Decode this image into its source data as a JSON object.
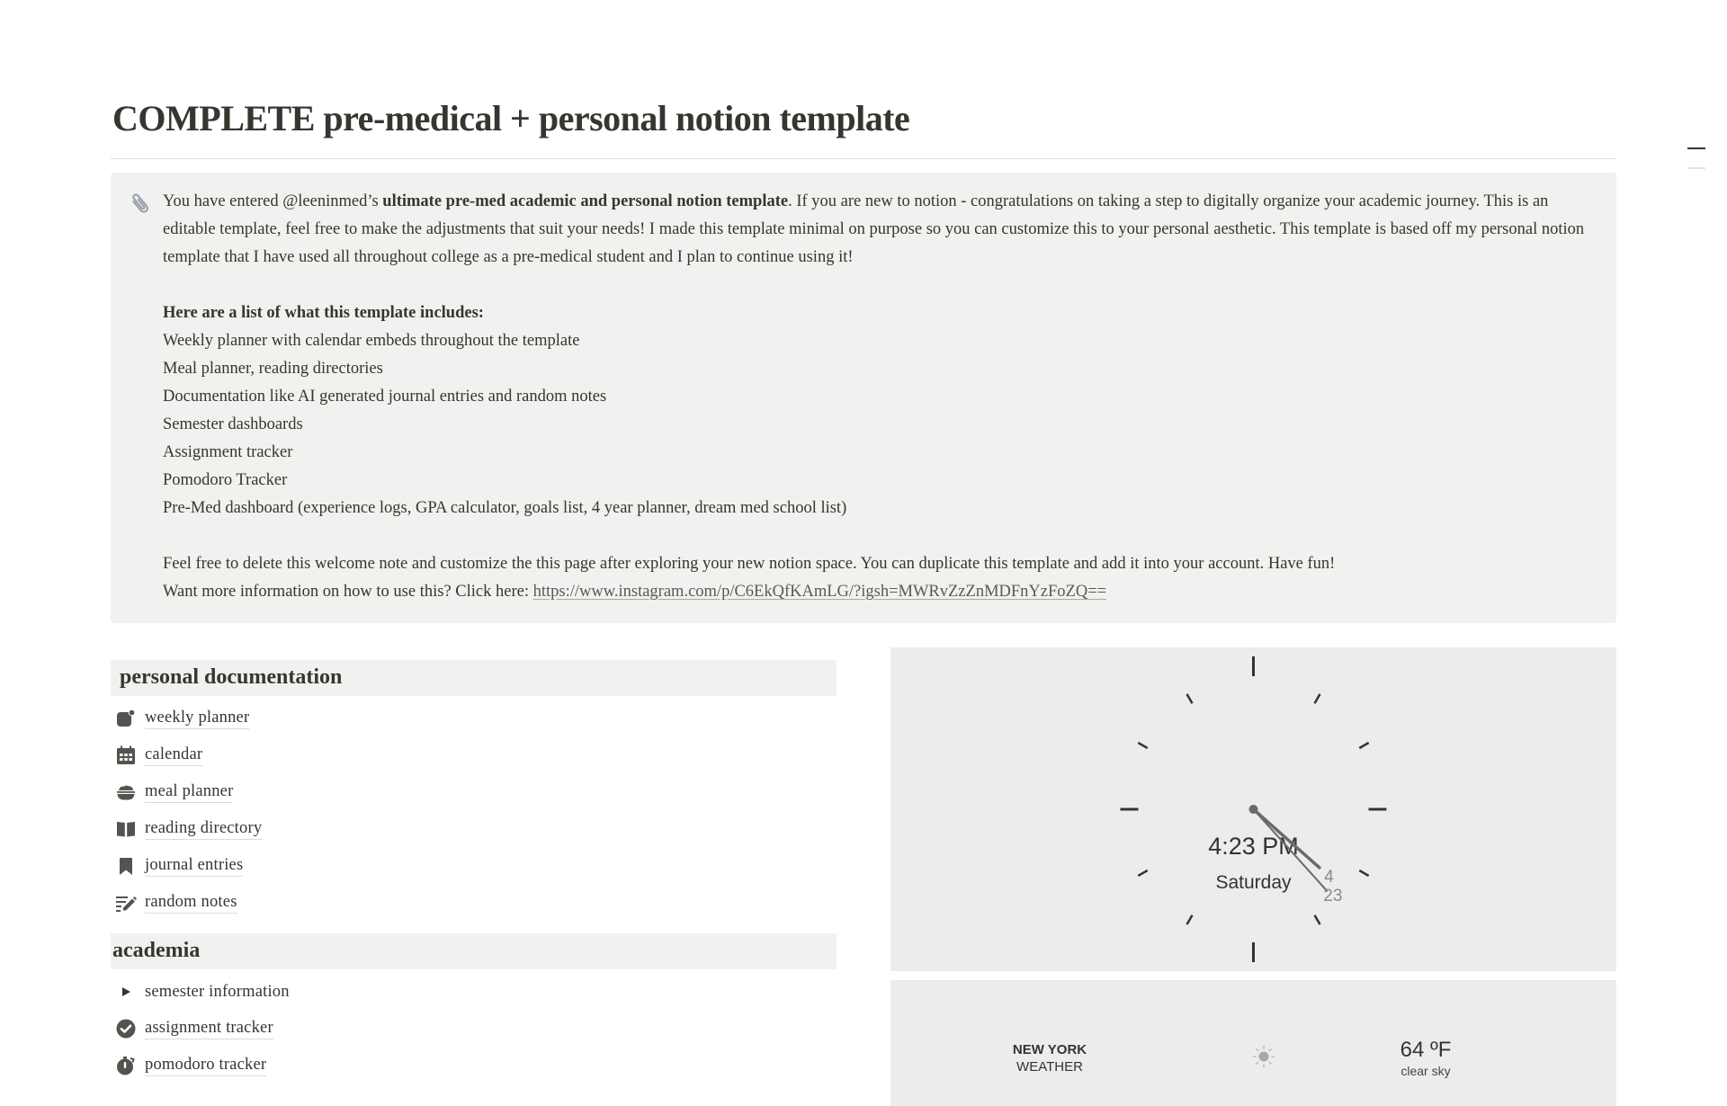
{
  "page": {
    "title": "COMPLETE pre-medical + personal notion template",
    "toc_icon": "table-of-contents-icon"
  },
  "callout": {
    "icon": "paperclip-icon",
    "intro_pre": "You have entered @leeninmed’s ",
    "intro_bold": "ultimate pre-med academic and personal notion template",
    "intro_post": ". If you are new to notion - congratulations on taking a step to digitally organize your academic journey. This is an editable template, feel free to make the adjustments that suit your needs! I made this template minimal on purpose so you can customize this to your personal aesthetic. This template is based off my personal notion template that I have used all throughout college as a pre-medical student and I plan to continue using it!",
    "list_heading": "Here are a list of what this template includes:",
    "list_items": [
      "Weekly planner with calendar embeds throughout the template",
      "Meal planner, reading directories",
      "Documentation like AI generated journal entries and random notes",
      "Semester dashboards",
      "Assignment tracker",
      "Pomodoro Tracker",
      "Pre-Med dashboard (experience logs, GPA calculator, goals list, 4 year planner, dream med school list)"
    ],
    "closing": "Feel free to delete this welcome note and customize the this page after exploring your new notion space. You can duplicate this template and add it into your account. Have fun!",
    "more_info_label": "Want more information on how to use this? Click here: ",
    "more_info_link": "https://www.instagram.com/p/C6EkQfKAmLG/?igsh=MWRvZzZnMDFnYzFoZQ=="
  },
  "sections": [
    {
      "heading": "personal documentation",
      "items": [
        {
          "label": "weekly planner",
          "icon": "notification-square-icon"
        },
        {
          "label": "calendar",
          "icon": "calendar-icon"
        },
        {
          "label": "meal planner",
          "icon": "bowl-icon"
        },
        {
          "label": "reading directory",
          "icon": "open-book-icon"
        },
        {
          "label": "journal entries",
          "icon": "bookmark-icon"
        },
        {
          "label": "random notes",
          "icon": "edit-notes-icon"
        }
      ]
    },
    {
      "heading": "academia",
      "items": [
        {
          "label": "semester information",
          "icon": "toggle-triangle-icon"
        },
        {
          "label": "assignment tracker",
          "icon": "check-circle-icon"
        },
        {
          "label": "pomodoro tracker",
          "icon": "stopwatch-icon"
        }
      ]
    }
  ],
  "clock": {
    "time_text": "4:23 PM",
    "day_text": "Saturday",
    "hour": 4,
    "minute": 23,
    "hour_label": "4",
    "minute_label": "23"
  },
  "weather": {
    "city": "NEW YORK",
    "subtitle": "WEATHER",
    "icon": "sun-icon",
    "temperature": "64 ºF",
    "condition": "clear sky"
  },
  "colors": {
    "text": "#37352f",
    "callout_bg": "#f1f1ef",
    "widget_bg": "#ebeced"
  }
}
